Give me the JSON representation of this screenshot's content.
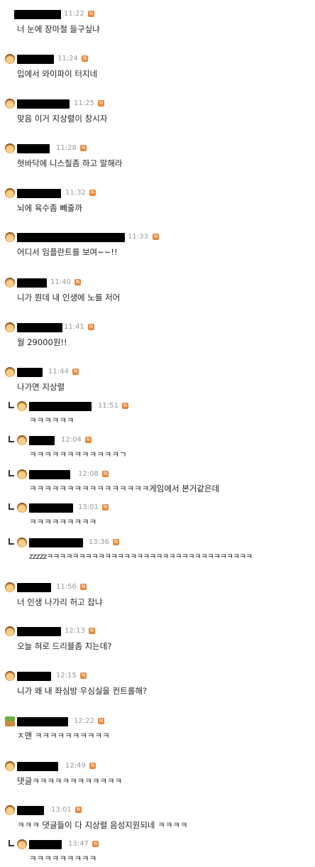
{
  "comments": [
    {
      "time": "11:22",
      "new": "N",
      "text": "너 눈에 장마철 들구싶냐"
    },
    {
      "time": "11:24",
      "new": "N",
      "text": "입에서 와이파이 터지네"
    },
    {
      "time": "11:25",
      "new": "N",
      "text": "맞음 이거 지상렬이 창시자"
    },
    {
      "time": "11:28",
      "new": "N",
      "text": "혓바닥에 니스칠좀 하고 말해라"
    },
    {
      "time": "11:32",
      "new": "N",
      "text": "뇌에 육수좀 빼줄까"
    },
    {
      "time": "11:33",
      "new": "N",
      "text": "어디서 임플란트를 보여~~!!"
    },
    {
      "time": "11:40",
      "new": "N",
      "text": "니가 뭔데 내 인생에 노를 저어"
    },
    {
      "time": "11:41",
      "new": "N",
      "text": "월 29000원!!"
    },
    {
      "time": "11:44",
      "new": "N",
      "text": "나가면 지상렬"
    },
    {
      "time": "11:51",
      "new": "N",
      "text": "ㅋㅋㅋㅋㅋㅋ"
    },
    {
      "time": "12:04",
      "new": "N",
      "text": "ㅋㅋㅋㅋㅋㅋㅋㅋㅋㅋㅋㅋㄱ"
    },
    {
      "time": "12:08",
      "new": "N",
      "text": "ㅋㅋㅋㅋㅋㅋㅋㅋㅋㅋㅋㅋㅋㅋㅋㅋ게임에서 본거같은데"
    },
    {
      "time": "13:01",
      "new": "N",
      "text": "ㅋㅋㅋㅋㅋㅋㅋㅋㅋ"
    },
    {
      "time": "13:36",
      "new": "N",
      "text": "zzzzzㅋㅋㅋㅋㅋㅋㅋㅋㅋㅋㅋㅋㅋㅋㅋㅋㅋㅋㅋㅋㅋㅋㅋㅋㅋㅋㅋㅋㅋㅋㅋㅋ"
    },
    {
      "time": "11:56",
      "new": "N",
      "text": "너 인생 나가리 허고 잡냐"
    },
    {
      "time": "12:13",
      "new": "N",
      "text": "오늘 혀로 드리블좀 치는데?"
    },
    {
      "time": "12:15",
      "new": "N",
      "text": "니가 왜 내 좌심방 우심실을 컨트롤해?"
    },
    {
      "time": "12:22",
      "new": "N",
      "text": "ㅈ맨 ㅋㅋㅋㅋㅋㅋㅋㅋㅋㅋ"
    },
    {
      "time": "12:49",
      "new": "N",
      "text": "댓글ㅋㅋㅋㅋㅋㅋㅋㅋㅋㅋㅋㅋ"
    },
    {
      "time": "13:01",
      "new": "N",
      "text": "ㅋㅋㅋ 댓글들이 다 지상렬 음성지원되네 ㅋㅋㅋㅋ"
    },
    {
      "time": "13:47",
      "new": "N",
      "text": "ㅋㅋㅋㅋㅋㅋㅋㅋㅋ"
    }
  ]
}
